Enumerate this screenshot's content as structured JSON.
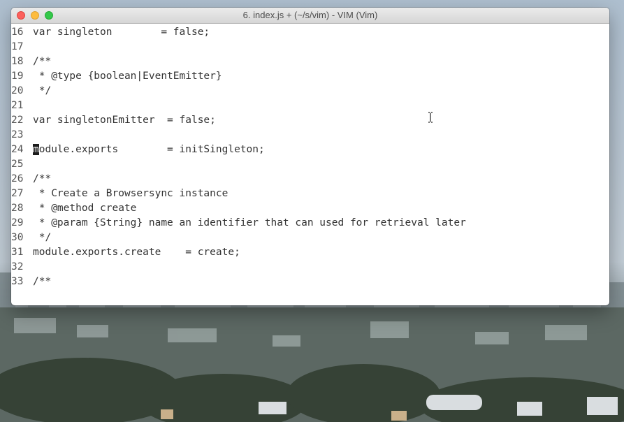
{
  "window": {
    "title": "6. index.js + (~/s/vim) - VIM (Vim)"
  },
  "editor": {
    "cursor_line": "24",
    "lines": [
      {
        "num": "16",
        "text": "var singleton        = false;"
      },
      {
        "num": "17",
        "text": ""
      },
      {
        "num": "18",
        "text": "/**"
      },
      {
        "num": "19",
        "text": " * @type {boolean|EventEmitter}"
      },
      {
        "num": "20",
        "text": " */"
      },
      {
        "num": "21",
        "text": ""
      },
      {
        "num": "22",
        "text": "var singletonEmitter  = false;"
      },
      {
        "num": "23",
        "text": ""
      },
      {
        "num": "24",
        "cursor_char": "m",
        "text": "odule.exports        = initSingleton;"
      },
      {
        "num": "25",
        "text": ""
      },
      {
        "num": "26",
        "text": "/**"
      },
      {
        "num": "27",
        "text": " * Create a Browsersync instance"
      },
      {
        "num": "28",
        "text": " * @method create"
      },
      {
        "num": "29",
        "text": " * @param {String} name an identifier that can used for retrieval later"
      },
      {
        "num": "30",
        "text": " */"
      },
      {
        "num": "31",
        "text": "module.exports.create    = create;"
      },
      {
        "num": "32",
        "text": ""
      },
      {
        "num": "33",
        "text": "/**"
      }
    ]
  }
}
